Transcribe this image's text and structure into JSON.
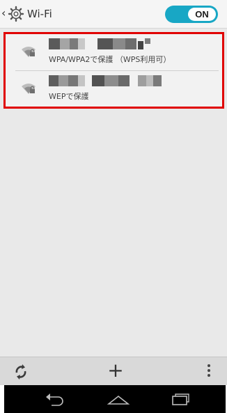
{
  "header": {
    "title": "Wi-Fi",
    "toggle_label": "ON",
    "toggle_color": "#18a7c5"
  },
  "networks": [
    {
      "ssid": "",
      "security": "WPA/WPA2で保護 （WPS利用可）",
      "icon": "wifi-locked-icon"
    },
    {
      "ssid": "",
      "security": "WEPで保護",
      "icon": "wifi-locked-icon"
    }
  ],
  "toolbar": {
    "icons": [
      "refresh-icon",
      "add-icon",
      "overflow-menu-icon"
    ]
  },
  "navbar": {
    "icons": [
      "back-icon",
      "home-icon",
      "recent-apps-icon"
    ]
  },
  "colors": {
    "highlight": "#e00000",
    "content_bg": "#e9e9e9"
  }
}
